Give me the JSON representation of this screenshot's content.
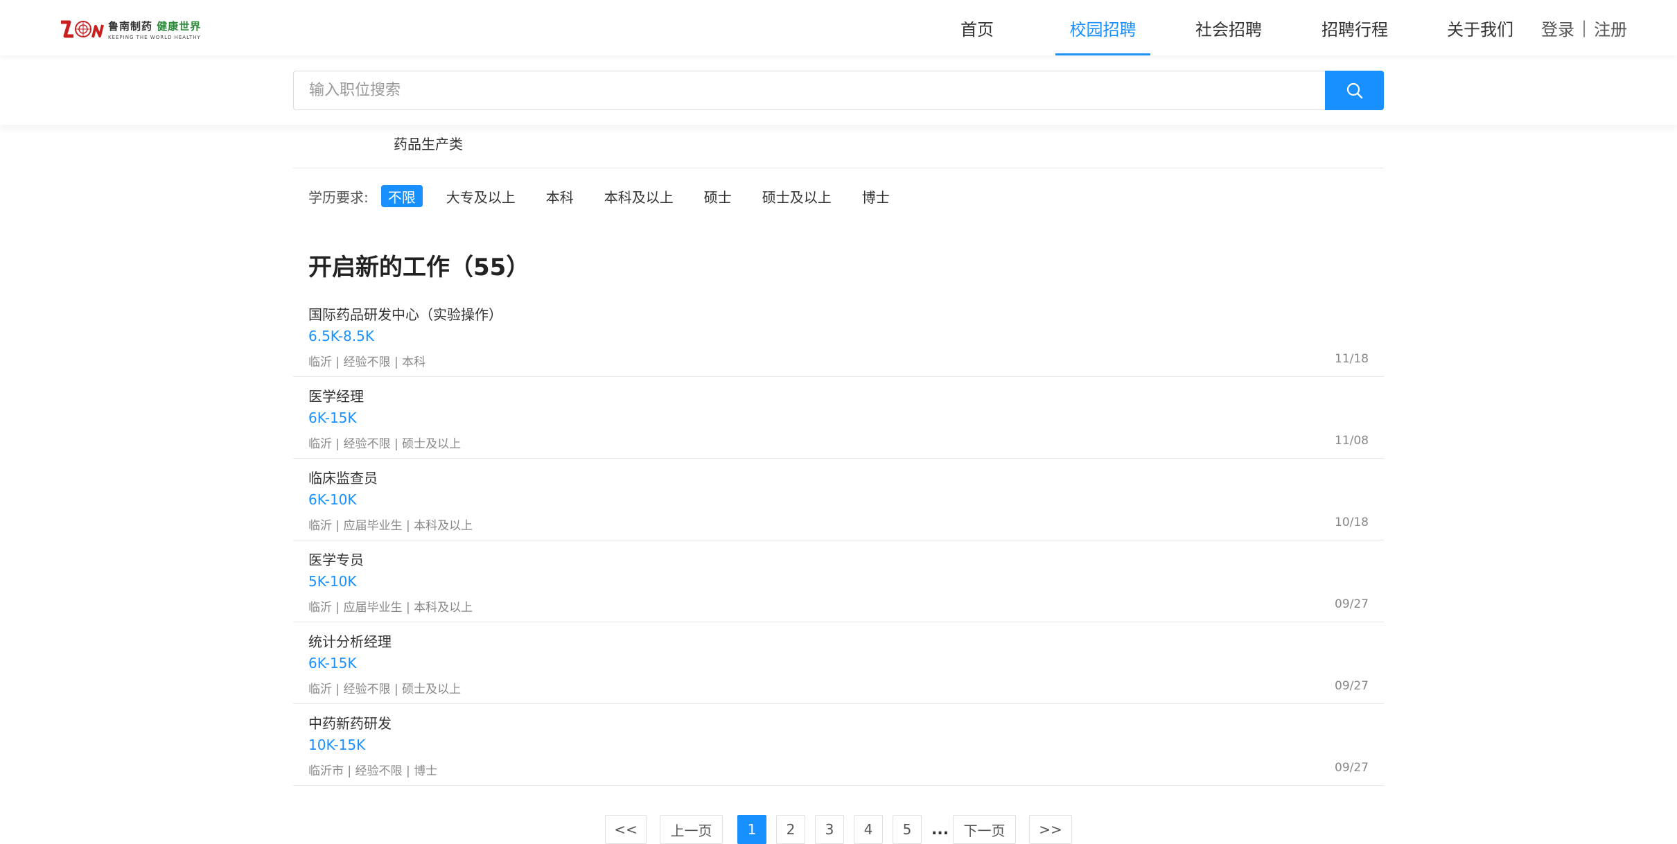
{
  "header": {
    "logo": {
      "cn_part1": "鲁南制药",
      "cn_part2": "健康世界",
      "en": "KEEPING THE WORLD HEALTHY"
    },
    "nav": [
      {
        "label": "首页",
        "active": false
      },
      {
        "label": "校园招聘",
        "active": true
      },
      {
        "label": "社会招聘",
        "active": false
      },
      {
        "label": "招聘行程",
        "active": false
      },
      {
        "label": "关于我们",
        "active": false
      }
    ],
    "login": "登录",
    "separator": "|",
    "register": "注册"
  },
  "search": {
    "placeholder": "输入职位搜索",
    "value": "",
    "icon": "search-icon"
  },
  "filters": {
    "category_value": "药品生产类",
    "education_label": "学历要求:",
    "education_options": [
      "不限",
      "大专及以上",
      "本科",
      "本科及以上",
      "硕士",
      "硕士及以上",
      "博士"
    ],
    "education_selected": "不限"
  },
  "section_title": "开启新的工作（55）",
  "jobs": [
    {
      "title": "国际药品研发中心（实验操作）",
      "salary": "6.5K-8.5K",
      "meta": "临沂 | 经验不限 | 本科",
      "date": "11/18"
    },
    {
      "title": "医学经理",
      "salary": "6K-15K",
      "meta": "临沂 | 经验不限 | 硕士及以上",
      "date": "11/08"
    },
    {
      "title": "临床监查员",
      "salary": "6K-10K",
      "meta": "临沂 | 应届毕业生 | 本科及以上",
      "date": "10/18"
    },
    {
      "title": "医学专员",
      "salary": "5K-10K",
      "meta": "临沂 | 应届毕业生 | 本科及以上",
      "date": "09/27"
    },
    {
      "title": "统计分析经理",
      "salary": "6K-15K",
      "meta": "临沂 | 经验不限 | 硕士及以上",
      "date": "09/27"
    },
    {
      "title": "中药新药研发",
      "salary": "10K-15K",
      "meta": "临沂市 | 经验不限 | 博士",
      "date": "09/27"
    }
  ],
  "pagination": {
    "first": "<<",
    "prev": "上一页",
    "pages": [
      "1",
      "2",
      "3",
      "4",
      "5"
    ],
    "current": "1",
    "ellipsis": "...",
    "next": "下一页",
    "last": ">>"
  },
  "colors": {
    "accent": "#1890ff",
    "text": "#333333",
    "muted": "#888888",
    "divider": "#e8e8e8"
  }
}
